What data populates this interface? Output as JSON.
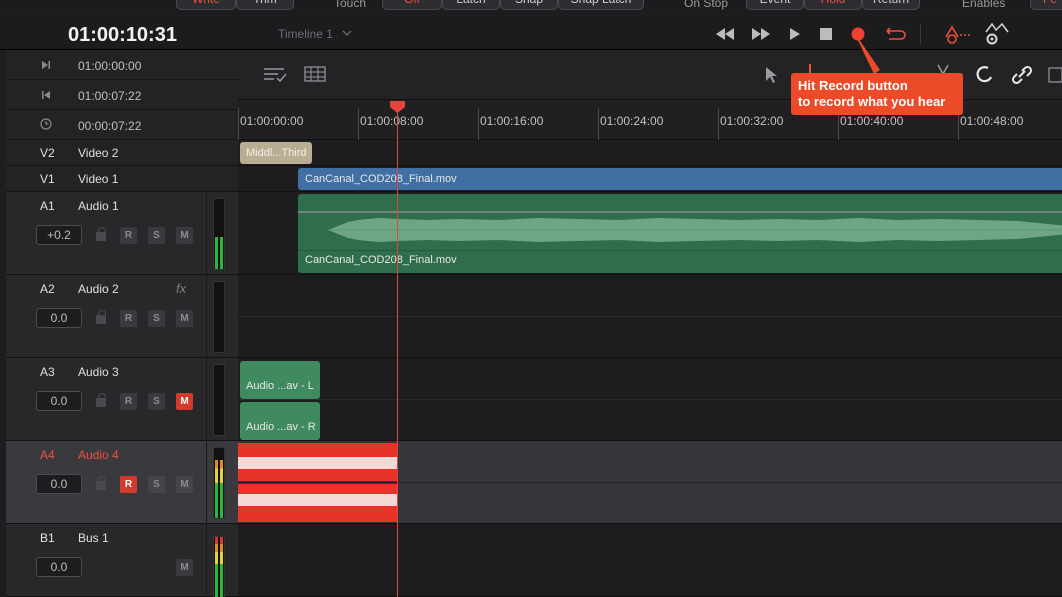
{
  "top_strip": {
    "write": "Write",
    "trim": "Trim",
    "touch": "Touch",
    "off": "Off",
    "latch": "Latch",
    "snap": "Snap",
    "snap_latch": "Snap Latch",
    "on_stop": "On Stop",
    "event": "Event",
    "hold": "Hold",
    "return": "Return",
    "enables": "Enables",
    "fe": "Fe"
  },
  "header": {
    "timecode": "01:00:10:31",
    "timeline_name": "Timeline 1"
  },
  "timecodes": {
    "in": "01:00:00:00",
    "out": "01:00:07:22",
    "duration": "00:00:07:22"
  },
  "ruler": [
    "01:00:00:00",
    "01:00:08:00",
    "01:00:16:00",
    "01:00:24:00",
    "01:00:32:00",
    "01:00:40:00",
    "01:00:48:00"
  ],
  "tracks": {
    "v2": {
      "id": "V2",
      "name": "Video 2"
    },
    "v1": {
      "id": "V1",
      "name": "Video 1"
    },
    "a1": {
      "id": "A1",
      "name": "Audio 1",
      "level": "+0.2"
    },
    "a2": {
      "id": "A2",
      "name": "Audio 2",
      "level": "0.0",
      "fx": "fx"
    },
    "a3": {
      "id": "A3",
      "name": "Audio 3",
      "level": "0.0"
    },
    "a4": {
      "id": "A4",
      "name": "Audio 4",
      "level": "0.0"
    },
    "b1": {
      "id": "B1",
      "name": "Bus 1",
      "level": "0.0"
    }
  },
  "buttons": {
    "r": "R",
    "s": "S",
    "m": "M"
  },
  "clips": {
    "title": "Middl...Third",
    "video": "CanCanal_COD208_Final.mov",
    "audio1": "CanCanal_COD208_Final.mov",
    "audio3_l": "Audio ...av - L",
    "audio3_r": "Audio ...av - R"
  },
  "callout": {
    "line1": "Hit Record button",
    "line2": "to record what you hear"
  },
  "colors": {
    "accent_red": "#ef4f3b",
    "callout": "#ec4a28",
    "video_clip": "#3f6fa3",
    "audio_clip": "#2f6e4c",
    "title_clip": "#b9ae94"
  }
}
